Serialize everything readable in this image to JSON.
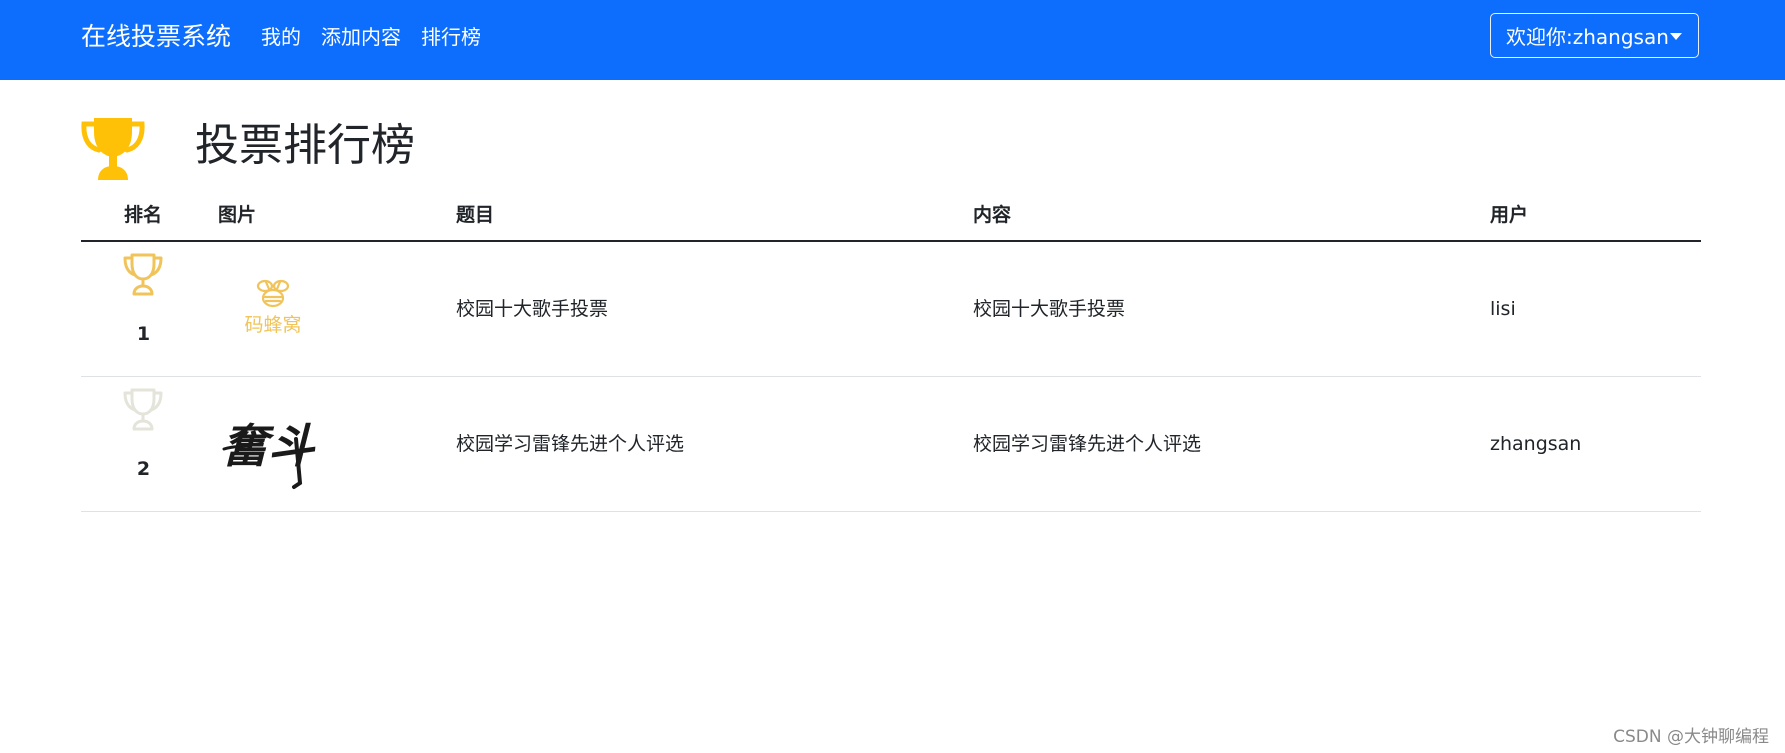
{
  "navbar": {
    "brand": "在线投票系统",
    "links": [
      "我的",
      "添加内容",
      "排行榜"
    ],
    "user_menu": "欢迎你:zhangsan",
    "bg_color": "#0d6efd"
  },
  "page": {
    "title": "投票排行榜",
    "title_icon": "trophy-icon",
    "title_icon_color": "#ffc107"
  },
  "table": {
    "headers": [
      "排名",
      "图片",
      "题目",
      "内容",
      "用户"
    ],
    "rows": [
      {
        "rank": "1",
        "rank_icon": "trophy-outline-icon",
        "rank_icon_color": "#f0c45a",
        "image": "mafengwo-logo",
        "image_text": "码蜂窝",
        "title": "校园十大歌手投票",
        "content": "校园十大歌手投票",
        "user": "lisi"
      },
      {
        "rank": "2",
        "rank_icon": "trophy-outline-icon",
        "rank_icon_color": "#e4e4da",
        "image": "fendou-calligraphy",
        "image_text": "奮斗",
        "title": "校园学习雷锋先进个人评选",
        "content": "校园学习雷锋先进个人评选",
        "user": "zhangsan"
      }
    ]
  },
  "watermark": "CSDN @大钟聊编程"
}
